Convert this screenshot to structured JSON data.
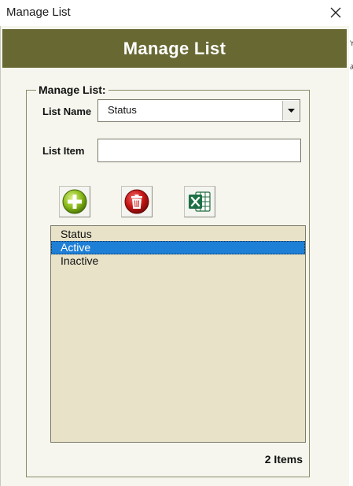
{
  "window": {
    "title": "Manage List"
  },
  "header": {
    "title": "Manage List"
  },
  "group": {
    "legend": "Manage List:",
    "list_name_label": "List Name",
    "list_name_value": "Status",
    "list_item_label": "List Item",
    "list_item_value": ""
  },
  "toolbar": {
    "add_icon": "plus-circle-icon",
    "delete_icon": "trash-icon",
    "excel_icon": "excel-icon"
  },
  "list": {
    "items": [
      {
        "label": "Status",
        "selected": false
      },
      {
        "label": "Active",
        "selected": true
      },
      {
        "label": "Inactive",
        "selected": false
      }
    ]
  },
  "footer": {
    "count_label": "2 Items"
  },
  "colors": {
    "header_bg": "#686833",
    "client_bg": "#f6f6ee",
    "list_bg": "#e7e2c8",
    "selection": "#1e7fd6"
  }
}
